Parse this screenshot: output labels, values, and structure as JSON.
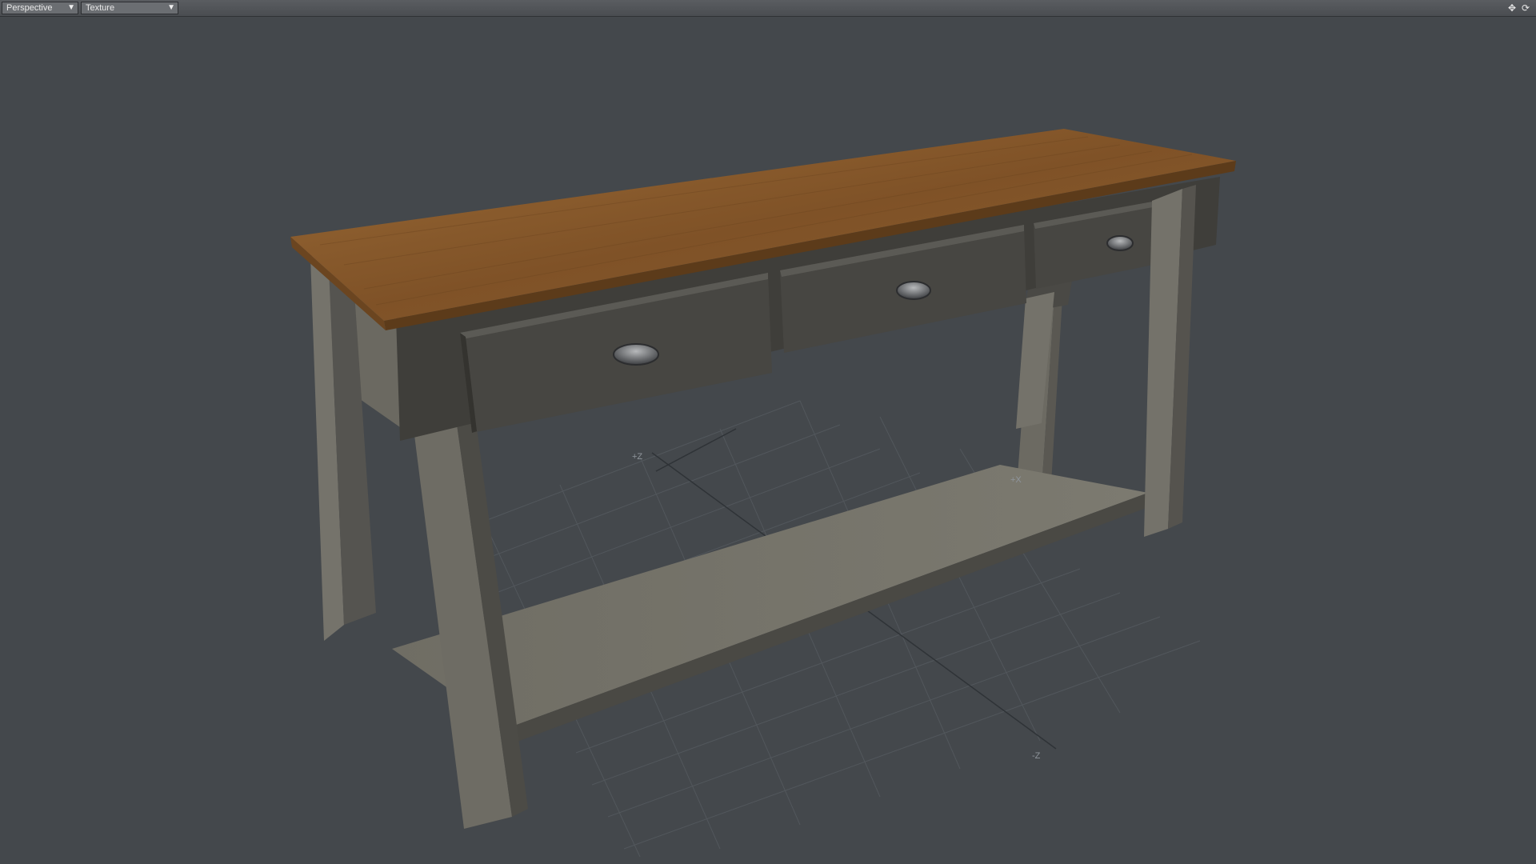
{
  "toolbar": {
    "view_mode": "Perspective",
    "shading_mode": "Texture",
    "move_icon": "move-view-icon",
    "rotate_icon": "rotate-view-icon"
  },
  "viewport": {
    "axis_labels": {
      "plus_z": "+Z",
      "plus_x": "+X",
      "minus_z": "-Z"
    },
    "object": "console-table",
    "colors": {
      "background": "#44484c",
      "wood_top": "#8a5a2b",
      "paint_light": "#7a786f",
      "paint_dark": "#3e3d39",
      "handle": "#6c6e70"
    }
  }
}
